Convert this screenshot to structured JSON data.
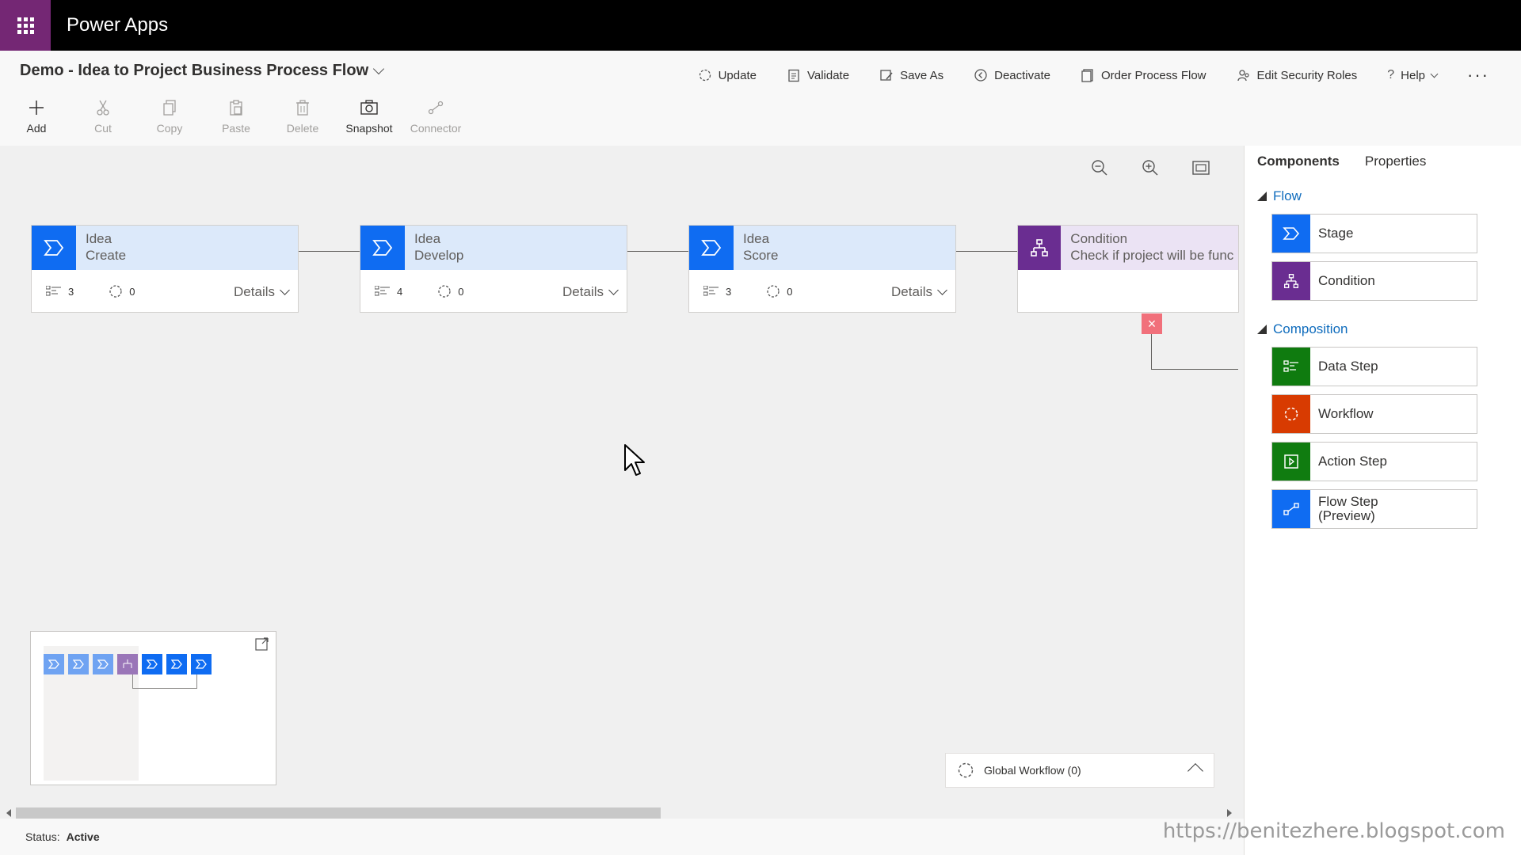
{
  "app": {
    "title": "Power Apps"
  },
  "header": {
    "process_title": "Demo - Idea to Project Business Process Flow",
    "actions": [
      {
        "label": "Update",
        "icon": "refresh-icon"
      },
      {
        "label": "Validate",
        "icon": "clipboard-check-icon"
      },
      {
        "label": "Save As",
        "icon": "save-as-icon"
      },
      {
        "label": "Deactivate",
        "icon": "deactivate-icon"
      },
      {
        "label": "Order Process Flow",
        "icon": "order-icon"
      },
      {
        "label": "Edit Security Roles",
        "icon": "people-icon"
      },
      {
        "label": "Help",
        "icon": "help-icon"
      }
    ],
    "more": "···"
  },
  "tools": [
    {
      "label": "Add",
      "enabled": true,
      "icon": "plus-icon"
    },
    {
      "label": "Cut",
      "enabled": false,
      "icon": "scissors-icon"
    },
    {
      "label": "Copy",
      "enabled": false,
      "icon": "copy-icon"
    },
    {
      "label": "Paste",
      "enabled": false,
      "icon": "paste-icon"
    },
    {
      "label": "Delete",
      "enabled": false,
      "icon": "trash-icon"
    },
    {
      "label": "Snapshot",
      "enabled": true,
      "icon": "camera-icon"
    },
    {
      "label": "Connector",
      "enabled": false,
      "icon": "connector-icon"
    }
  ],
  "stages": [
    {
      "entity": "Idea",
      "name": "Create",
      "steps": "3",
      "workflows": "0",
      "details": "Details"
    },
    {
      "entity": "Idea",
      "name": "Develop",
      "steps": "4",
      "workflows": "0",
      "details": "Details"
    },
    {
      "entity": "Idea",
      "name": "Score",
      "steps": "3",
      "workflows": "0",
      "details": "Details"
    }
  ],
  "condition": {
    "title": "Condition",
    "subtitle": "Check if project will be func"
  },
  "global_workflow": {
    "label": "Global Workflow (0)"
  },
  "status": {
    "label": "Status:",
    "value": "Active"
  },
  "panel": {
    "tabs": [
      "Components",
      "Properties"
    ],
    "active_tab": "Components",
    "flow_header": "Flow",
    "flow_items": [
      {
        "label": "Stage",
        "color": "#0f6cf2",
        "icon": "stage-chevron-icon"
      },
      {
        "label": "Condition",
        "color": "#6a2d91",
        "icon": "condition-branch-icon"
      }
    ],
    "composition_header": "Composition",
    "composition_items": [
      {
        "label": "Data Step",
        "color": "#0f7b0f",
        "icon": "data-step-icon"
      },
      {
        "label": "Workflow",
        "color": "#d83b01",
        "icon": "workflow-icon"
      },
      {
        "label": "Action Step",
        "color": "#107c10",
        "icon": "action-step-icon"
      },
      {
        "label": "Flow Step (Preview)",
        "line1": "Flow Step",
        "line2": "(Preview)",
        "color": "#0f6cf2",
        "icon": "flow-step-icon"
      }
    ]
  },
  "watermark": "https://benitezhere.blogspot.com",
  "colors": {
    "brand_purple": "#742774",
    "stage_blue": "#0f6cf2",
    "condition_purple": "#6a2d91"
  }
}
